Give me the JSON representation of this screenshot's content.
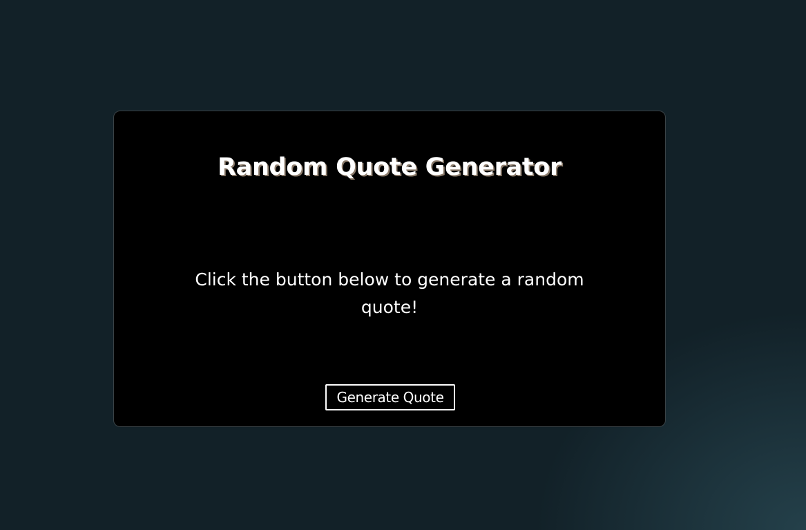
{
  "app": {
    "title": "Random Quote Generator"
  },
  "quote": {
    "text": "Click the button below to generate a random quote!"
  },
  "actions": {
    "generate_label": "Generate Quote"
  },
  "colors": {
    "background": "#122128",
    "card_background": "#000000",
    "text": "#ffffff",
    "title_shadow": "#8a7a6a",
    "card_border": "#3a4246"
  }
}
